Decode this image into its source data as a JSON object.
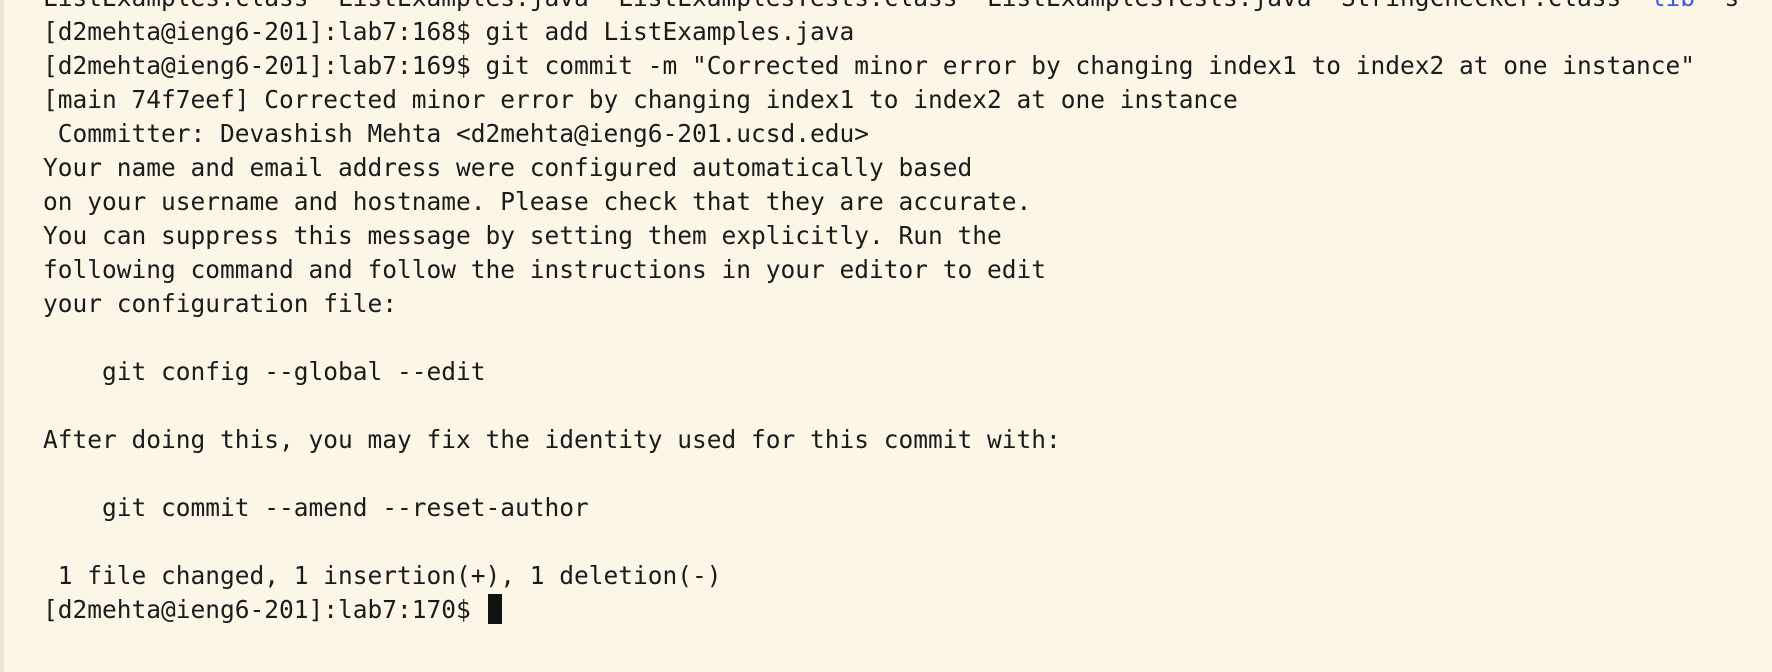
{
  "terminal": {
    "colors": {
      "background": "#fcf6e7",
      "text": "#1b1b1b",
      "link": "#3a5ee8",
      "cursor": "#111111"
    },
    "partial_line": {
      "p1": "ListExamples.class  ListExamples.java  ListExamplesTests.class  ListExamplesTests.java  StringChecker.class  ",
      "p2": "lib",
      "p3": "  s"
    },
    "lines": [
      "[d2mehta@ieng6-201]:lab7:168$ git add ListExamples.java",
      "[d2mehta@ieng6-201]:lab7:169$ git commit -m \"Corrected minor error by changing index1 to index2 at one instance\"",
      "[main 74f7eef] Corrected minor error by changing index1 to index2 at one instance",
      " Committer: Devashish Mehta <d2mehta@ieng6-201.ucsd.edu>",
      "Your name and email address were configured automatically based",
      "on your username and hostname. Please check that they are accurate.",
      "You can suppress this message by setting them explicitly. Run the",
      "following command and follow the instructions in your editor to edit",
      "your configuration file:",
      "",
      "    git config --global --edit",
      "",
      "After doing this, you may fix the identity used for this commit with:",
      "",
      "    git commit --amend --reset-author",
      "",
      " 1 file changed, 1 insertion(+), 1 deletion(-)"
    ],
    "prompt": "[d2mehta@ieng6-201]:lab7:170$ "
  }
}
